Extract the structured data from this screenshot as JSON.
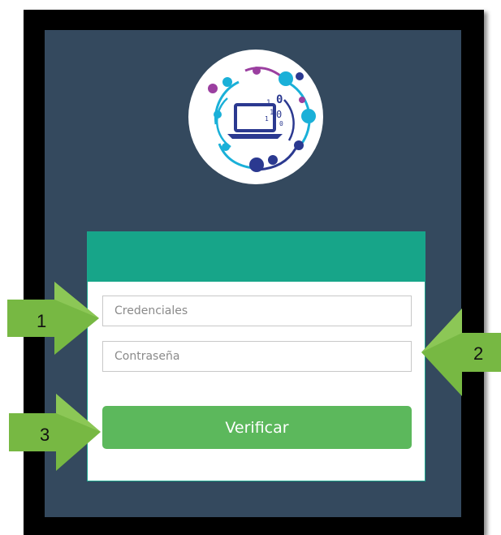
{
  "login": {
    "credentials_placeholder": "Credenciales",
    "password_placeholder": "Contraseña",
    "verify_label": "Verificar"
  },
  "callouts": {
    "one": "1",
    "two": "2",
    "three": "3"
  },
  "logo": {
    "icon": "laptop-network-icon",
    "binary_digits": [
      "1",
      "0",
      "1",
      "0",
      "1",
      "0"
    ]
  },
  "colors": {
    "panel_bg": "#34495e",
    "frame": "#000000",
    "card_header": "#17a589",
    "verify_button": "#5cb85c",
    "callout_arrow": "#77b843"
  }
}
